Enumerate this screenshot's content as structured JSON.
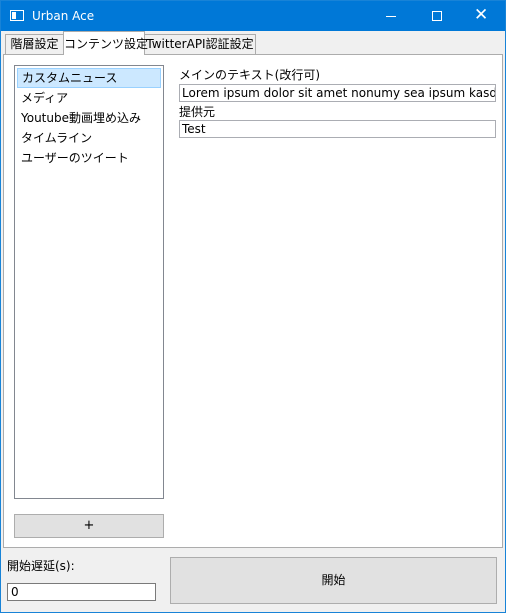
{
  "window": {
    "title": "Urban Ace",
    "icons": {
      "app": "app-window-icon",
      "minimize": "minimize-icon",
      "maximize": "maximize-icon",
      "close": "close-icon"
    },
    "close_glyph": "✕"
  },
  "tabs": [
    {
      "label": "階層設定",
      "active": false
    },
    {
      "label": "コンテンツ設定",
      "active": true
    },
    {
      "label": "TwitterAPI認証設定",
      "active": false
    }
  ],
  "content_list": {
    "items": [
      {
        "label": "カスタムニュース",
        "selected": true
      },
      {
        "label": "メディア",
        "selected": false
      },
      {
        "label": "Youtube動画埋め込み",
        "selected": false
      },
      {
        "label": "タイムライン",
        "selected": false
      },
      {
        "label": "ユーザーのツイート",
        "selected": false
      }
    ],
    "add_label": "+"
  },
  "detail": {
    "main_text_label": "メインのテキスト(改行可)",
    "main_text_value": "Lorem ipsum dolor sit amet nonumy sea ipsum kasd eirmod",
    "provider_label": "提供元",
    "provider_value": "Test"
  },
  "footer": {
    "delay_label": "開始遅延(s):",
    "delay_value": "0",
    "start_label": "開始"
  }
}
